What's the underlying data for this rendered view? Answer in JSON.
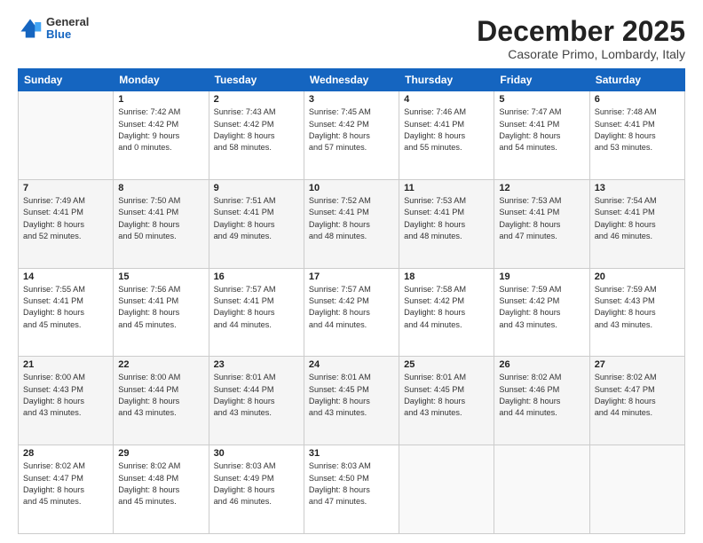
{
  "header": {
    "logo_general": "General",
    "logo_blue": "Blue",
    "month_title": "December 2025",
    "location": "Casorate Primo, Lombardy, Italy"
  },
  "weekdays": [
    "Sunday",
    "Monday",
    "Tuesday",
    "Wednesday",
    "Thursday",
    "Friday",
    "Saturday"
  ],
  "weeks": [
    [
      {
        "day": "",
        "info": ""
      },
      {
        "day": "1",
        "info": "Sunrise: 7:42 AM\nSunset: 4:42 PM\nDaylight: 9 hours\nand 0 minutes."
      },
      {
        "day": "2",
        "info": "Sunrise: 7:43 AM\nSunset: 4:42 PM\nDaylight: 8 hours\nand 58 minutes."
      },
      {
        "day": "3",
        "info": "Sunrise: 7:45 AM\nSunset: 4:42 PM\nDaylight: 8 hours\nand 57 minutes."
      },
      {
        "day": "4",
        "info": "Sunrise: 7:46 AM\nSunset: 4:41 PM\nDaylight: 8 hours\nand 55 minutes."
      },
      {
        "day": "5",
        "info": "Sunrise: 7:47 AM\nSunset: 4:41 PM\nDaylight: 8 hours\nand 54 minutes."
      },
      {
        "day": "6",
        "info": "Sunrise: 7:48 AM\nSunset: 4:41 PM\nDaylight: 8 hours\nand 53 minutes."
      }
    ],
    [
      {
        "day": "7",
        "info": "Sunrise: 7:49 AM\nSunset: 4:41 PM\nDaylight: 8 hours\nand 52 minutes."
      },
      {
        "day": "8",
        "info": "Sunrise: 7:50 AM\nSunset: 4:41 PM\nDaylight: 8 hours\nand 50 minutes."
      },
      {
        "day": "9",
        "info": "Sunrise: 7:51 AM\nSunset: 4:41 PM\nDaylight: 8 hours\nand 49 minutes."
      },
      {
        "day": "10",
        "info": "Sunrise: 7:52 AM\nSunset: 4:41 PM\nDaylight: 8 hours\nand 48 minutes."
      },
      {
        "day": "11",
        "info": "Sunrise: 7:53 AM\nSunset: 4:41 PM\nDaylight: 8 hours\nand 48 minutes."
      },
      {
        "day": "12",
        "info": "Sunrise: 7:53 AM\nSunset: 4:41 PM\nDaylight: 8 hours\nand 47 minutes."
      },
      {
        "day": "13",
        "info": "Sunrise: 7:54 AM\nSunset: 4:41 PM\nDaylight: 8 hours\nand 46 minutes."
      }
    ],
    [
      {
        "day": "14",
        "info": "Sunrise: 7:55 AM\nSunset: 4:41 PM\nDaylight: 8 hours\nand 45 minutes."
      },
      {
        "day": "15",
        "info": "Sunrise: 7:56 AM\nSunset: 4:41 PM\nDaylight: 8 hours\nand 45 minutes."
      },
      {
        "day": "16",
        "info": "Sunrise: 7:57 AM\nSunset: 4:41 PM\nDaylight: 8 hours\nand 44 minutes."
      },
      {
        "day": "17",
        "info": "Sunrise: 7:57 AM\nSunset: 4:42 PM\nDaylight: 8 hours\nand 44 minutes."
      },
      {
        "day": "18",
        "info": "Sunrise: 7:58 AM\nSunset: 4:42 PM\nDaylight: 8 hours\nand 44 minutes."
      },
      {
        "day": "19",
        "info": "Sunrise: 7:59 AM\nSunset: 4:42 PM\nDaylight: 8 hours\nand 43 minutes."
      },
      {
        "day": "20",
        "info": "Sunrise: 7:59 AM\nSunset: 4:43 PM\nDaylight: 8 hours\nand 43 minutes."
      }
    ],
    [
      {
        "day": "21",
        "info": "Sunrise: 8:00 AM\nSunset: 4:43 PM\nDaylight: 8 hours\nand 43 minutes."
      },
      {
        "day": "22",
        "info": "Sunrise: 8:00 AM\nSunset: 4:44 PM\nDaylight: 8 hours\nand 43 minutes."
      },
      {
        "day": "23",
        "info": "Sunrise: 8:01 AM\nSunset: 4:44 PM\nDaylight: 8 hours\nand 43 minutes."
      },
      {
        "day": "24",
        "info": "Sunrise: 8:01 AM\nSunset: 4:45 PM\nDaylight: 8 hours\nand 43 minutes."
      },
      {
        "day": "25",
        "info": "Sunrise: 8:01 AM\nSunset: 4:45 PM\nDaylight: 8 hours\nand 43 minutes."
      },
      {
        "day": "26",
        "info": "Sunrise: 8:02 AM\nSunset: 4:46 PM\nDaylight: 8 hours\nand 44 minutes."
      },
      {
        "day": "27",
        "info": "Sunrise: 8:02 AM\nSunset: 4:47 PM\nDaylight: 8 hours\nand 44 minutes."
      }
    ],
    [
      {
        "day": "28",
        "info": "Sunrise: 8:02 AM\nSunset: 4:47 PM\nDaylight: 8 hours\nand 45 minutes."
      },
      {
        "day": "29",
        "info": "Sunrise: 8:02 AM\nSunset: 4:48 PM\nDaylight: 8 hours\nand 45 minutes."
      },
      {
        "day": "30",
        "info": "Sunrise: 8:03 AM\nSunset: 4:49 PM\nDaylight: 8 hours\nand 46 minutes."
      },
      {
        "day": "31",
        "info": "Sunrise: 8:03 AM\nSunset: 4:50 PM\nDaylight: 8 hours\nand 47 minutes."
      },
      {
        "day": "",
        "info": ""
      },
      {
        "day": "",
        "info": ""
      },
      {
        "day": "",
        "info": ""
      }
    ]
  ]
}
